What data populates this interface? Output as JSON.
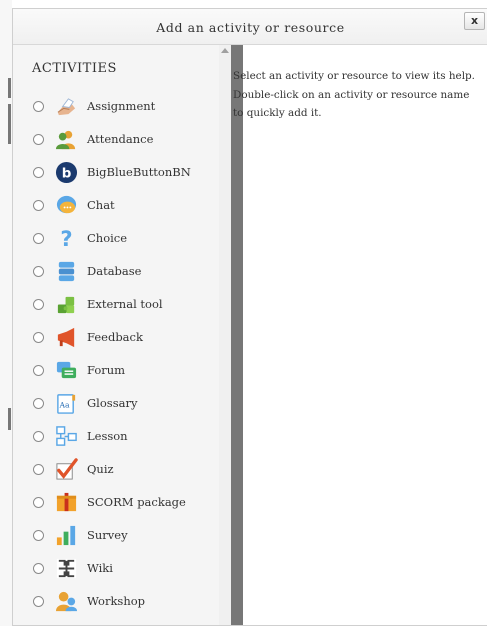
{
  "dialog": {
    "title": "Add an activity or resource",
    "close_label": "x"
  },
  "options": {
    "section_title": "ACTIVITIES",
    "items": [
      {
        "label": "Assignment",
        "icon": "assignment-icon"
      },
      {
        "label": "Attendance",
        "icon": "attendance-icon"
      },
      {
        "label": "BigBlueButtonBN",
        "icon": "bigbluebutton-icon"
      },
      {
        "label": "Chat",
        "icon": "chat-icon"
      },
      {
        "label": "Choice",
        "icon": "choice-icon"
      },
      {
        "label": "Database",
        "icon": "database-icon"
      },
      {
        "label": "External tool",
        "icon": "external-tool-icon"
      },
      {
        "label": "Feedback",
        "icon": "feedback-icon"
      },
      {
        "label": "Forum",
        "icon": "forum-icon"
      },
      {
        "label": "Glossary",
        "icon": "glossary-icon"
      },
      {
        "label": "Lesson",
        "icon": "lesson-icon"
      },
      {
        "label": "Quiz",
        "icon": "quiz-icon"
      },
      {
        "label": "SCORM package",
        "icon": "scorm-package-icon"
      },
      {
        "label": "Survey",
        "icon": "survey-icon"
      },
      {
        "label": "Wiki",
        "icon": "wiki-icon"
      },
      {
        "label": "Workshop",
        "icon": "workshop-icon"
      }
    ]
  },
  "help": {
    "text": "Select an activity or resource to view its help. Double-click on an activity or resource name to quickly add it."
  }
}
